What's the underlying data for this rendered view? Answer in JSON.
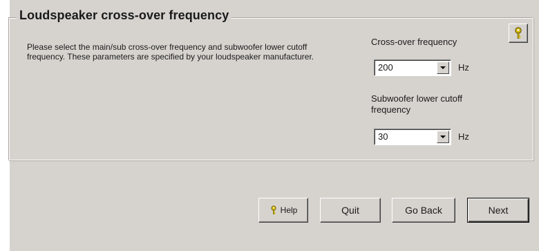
{
  "group": {
    "title": "Loudspeaker cross-over frequency",
    "description": "Please select the main/sub cross-over frequency and subwoofer lower cutoff frequency. These parameters are specified by your loudspeaker manufacturer."
  },
  "crossover": {
    "label": "Cross-over frequency",
    "value": "200",
    "unit": "Hz"
  },
  "subwoofer": {
    "label": "Subwoofer lower cutoff frequency",
    "value": "30",
    "unit": "Hz"
  },
  "buttons": {
    "help": "Help",
    "quit": "Quit",
    "back": "Go Back",
    "next": "Next"
  },
  "icons": {
    "help": "key-help-icon",
    "dropdown": "chevron-down-icon"
  },
  "colors": {
    "window_bg": "#d6d3ce",
    "help_icon": "#d4b800"
  }
}
